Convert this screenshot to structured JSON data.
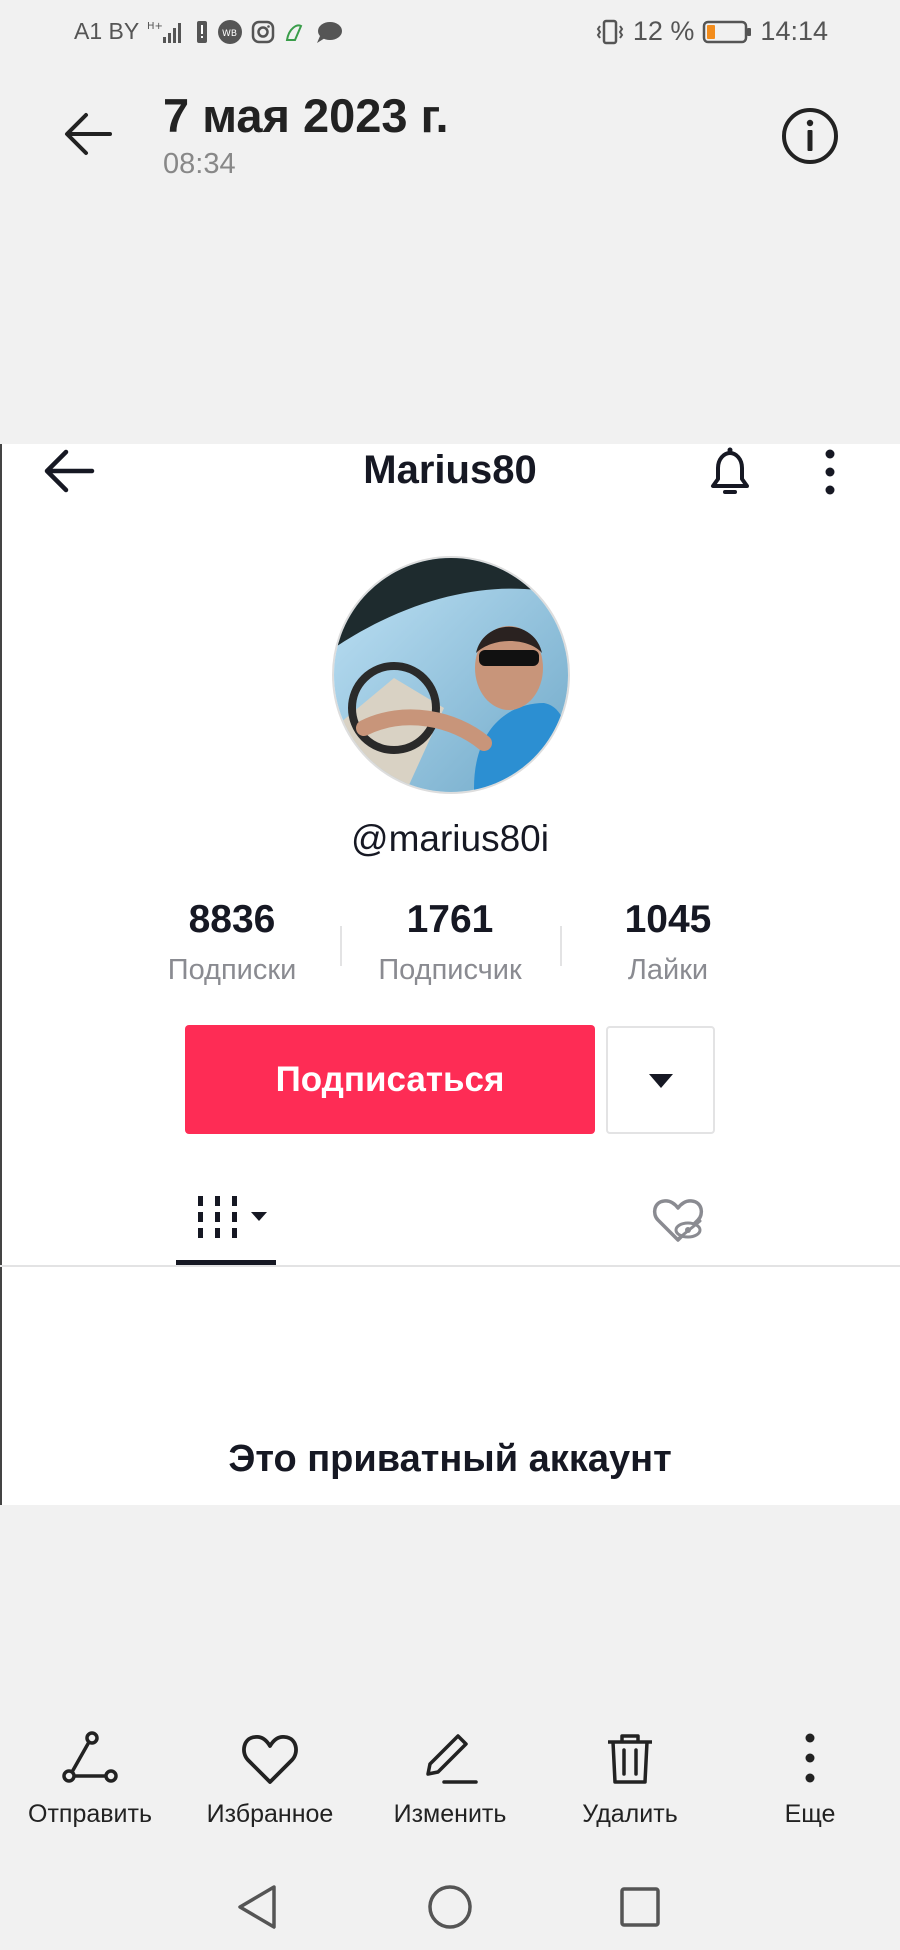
{
  "status_bar": {
    "carrier": "A1 BY",
    "battery_percent": "12 %",
    "time": "14:14",
    "icons": [
      "network-icon",
      "signal-icon",
      "alert-icon",
      "wb-icon",
      "instagram-icon",
      "app-icon",
      "chat-icon",
      "vibrate-icon",
      "battery-icon"
    ]
  },
  "viewer": {
    "date": "7 мая 2023 г.",
    "time": "08:34"
  },
  "profile": {
    "name": "Marius80",
    "handle": "@marius80i",
    "stats": [
      {
        "value": "8836",
        "label": "Подписки"
      },
      {
        "value": "1761",
        "label": "Подписчик"
      },
      {
        "value": "1045",
        "label": "Лайки"
      }
    ],
    "follow_label": "Подписаться",
    "private_text": "Это приватный аккаунт"
  },
  "actions": [
    {
      "label": "Отправить",
      "icon": "share-icon"
    },
    {
      "label": "Избранное",
      "icon": "heart-icon"
    },
    {
      "label": "Изменить",
      "icon": "edit-icon"
    },
    {
      "label": "Удалить",
      "icon": "trash-icon"
    },
    {
      "label": "Еще",
      "icon": "more-vertical-icon"
    }
  ],
  "colors": {
    "accent": "#fe2c55",
    "background": "#f1f1f1",
    "panel": "#ffffff",
    "text": "#161823",
    "muted": "#8a8b91"
  }
}
